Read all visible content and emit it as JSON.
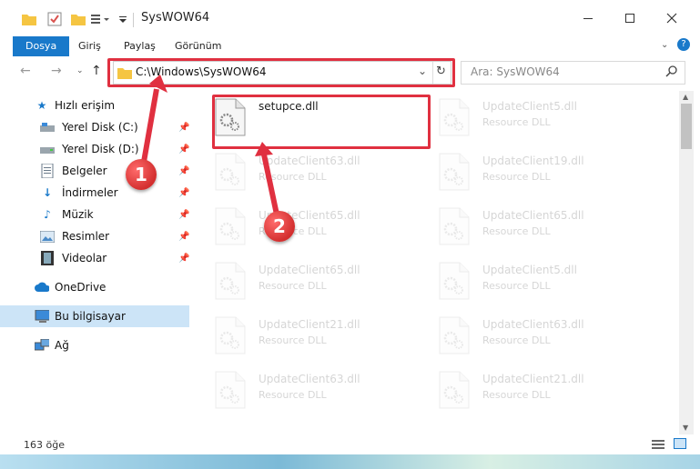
{
  "window": {
    "title": "SysWOW64"
  },
  "ribbon": {
    "tabs": [
      "Dosya",
      "Giriş",
      "Paylaş",
      "Görünüm"
    ]
  },
  "address": {
    "path": "C:\\Windows\\SysWOW64"
  },
  "search": {
    "placeholder": "Ara: SysWOW64"
  },
  "sidebar": {
    "quick_access": "Hızlı erişim",
    "items": [
      "Yerel Disk (C:)",
      "Yerel Disk (D:)",
      "Belgeler",
      "İndirmeler",
      "Müzik",
      "Resimler",
      "Videolar"
    ],
    "onedrive": "OneDrive",
    "this_pc": "Bu bilgisayar",
    "network": "Ağ"
  },
  "files": [
    {
      "name": "setupce.dll",
      "type": ""
    },
    {
      "name": "UpdateClient5.dll",
      "type": "Resource DLL"
    },
    {
      "name": "UpdateClient63.dll",
      "type": "Resource DLL"
    },
    {
      "name": "UpdateClient19.dll",
      "type": "Resource DLL"
    },
    {
      "name": "UpdateClient65.dll",
      "type": "Resource DLL"
    },
    {
      "name": "UpdateClient65.dll",
      "type": "Resource DLL"
    },
    {
      "name": "UpdateClient65.dll",
      "type": "Resource DLL"
    },
    {
      "name": "UpdateClient5.dll",
      "type": "Resource DLL"
    },
    {
      "name": "UpdateClient21.dll",
      "type": "Resource DLL"
    },
    {
      "name": "UpdateClient63.dll",
      "type": "Resource DLL"
    },
    {
      "name": "UpdateClient63.dll",
      "type": "Resource DLL"
    },
    {
      "name": "UpdateClient21.dll",
      "type": "Resource DLL"
    }
  ],
  "status": {
    "count": "163 öğe"
  },
  "annotations": {
    "step1": "1",
    "step2": "2"
  },
  "colors": {
    "accent": "#1979ca",
    "highlight": "#e03040",
    "selected": "#cce4f7"
  }
}
